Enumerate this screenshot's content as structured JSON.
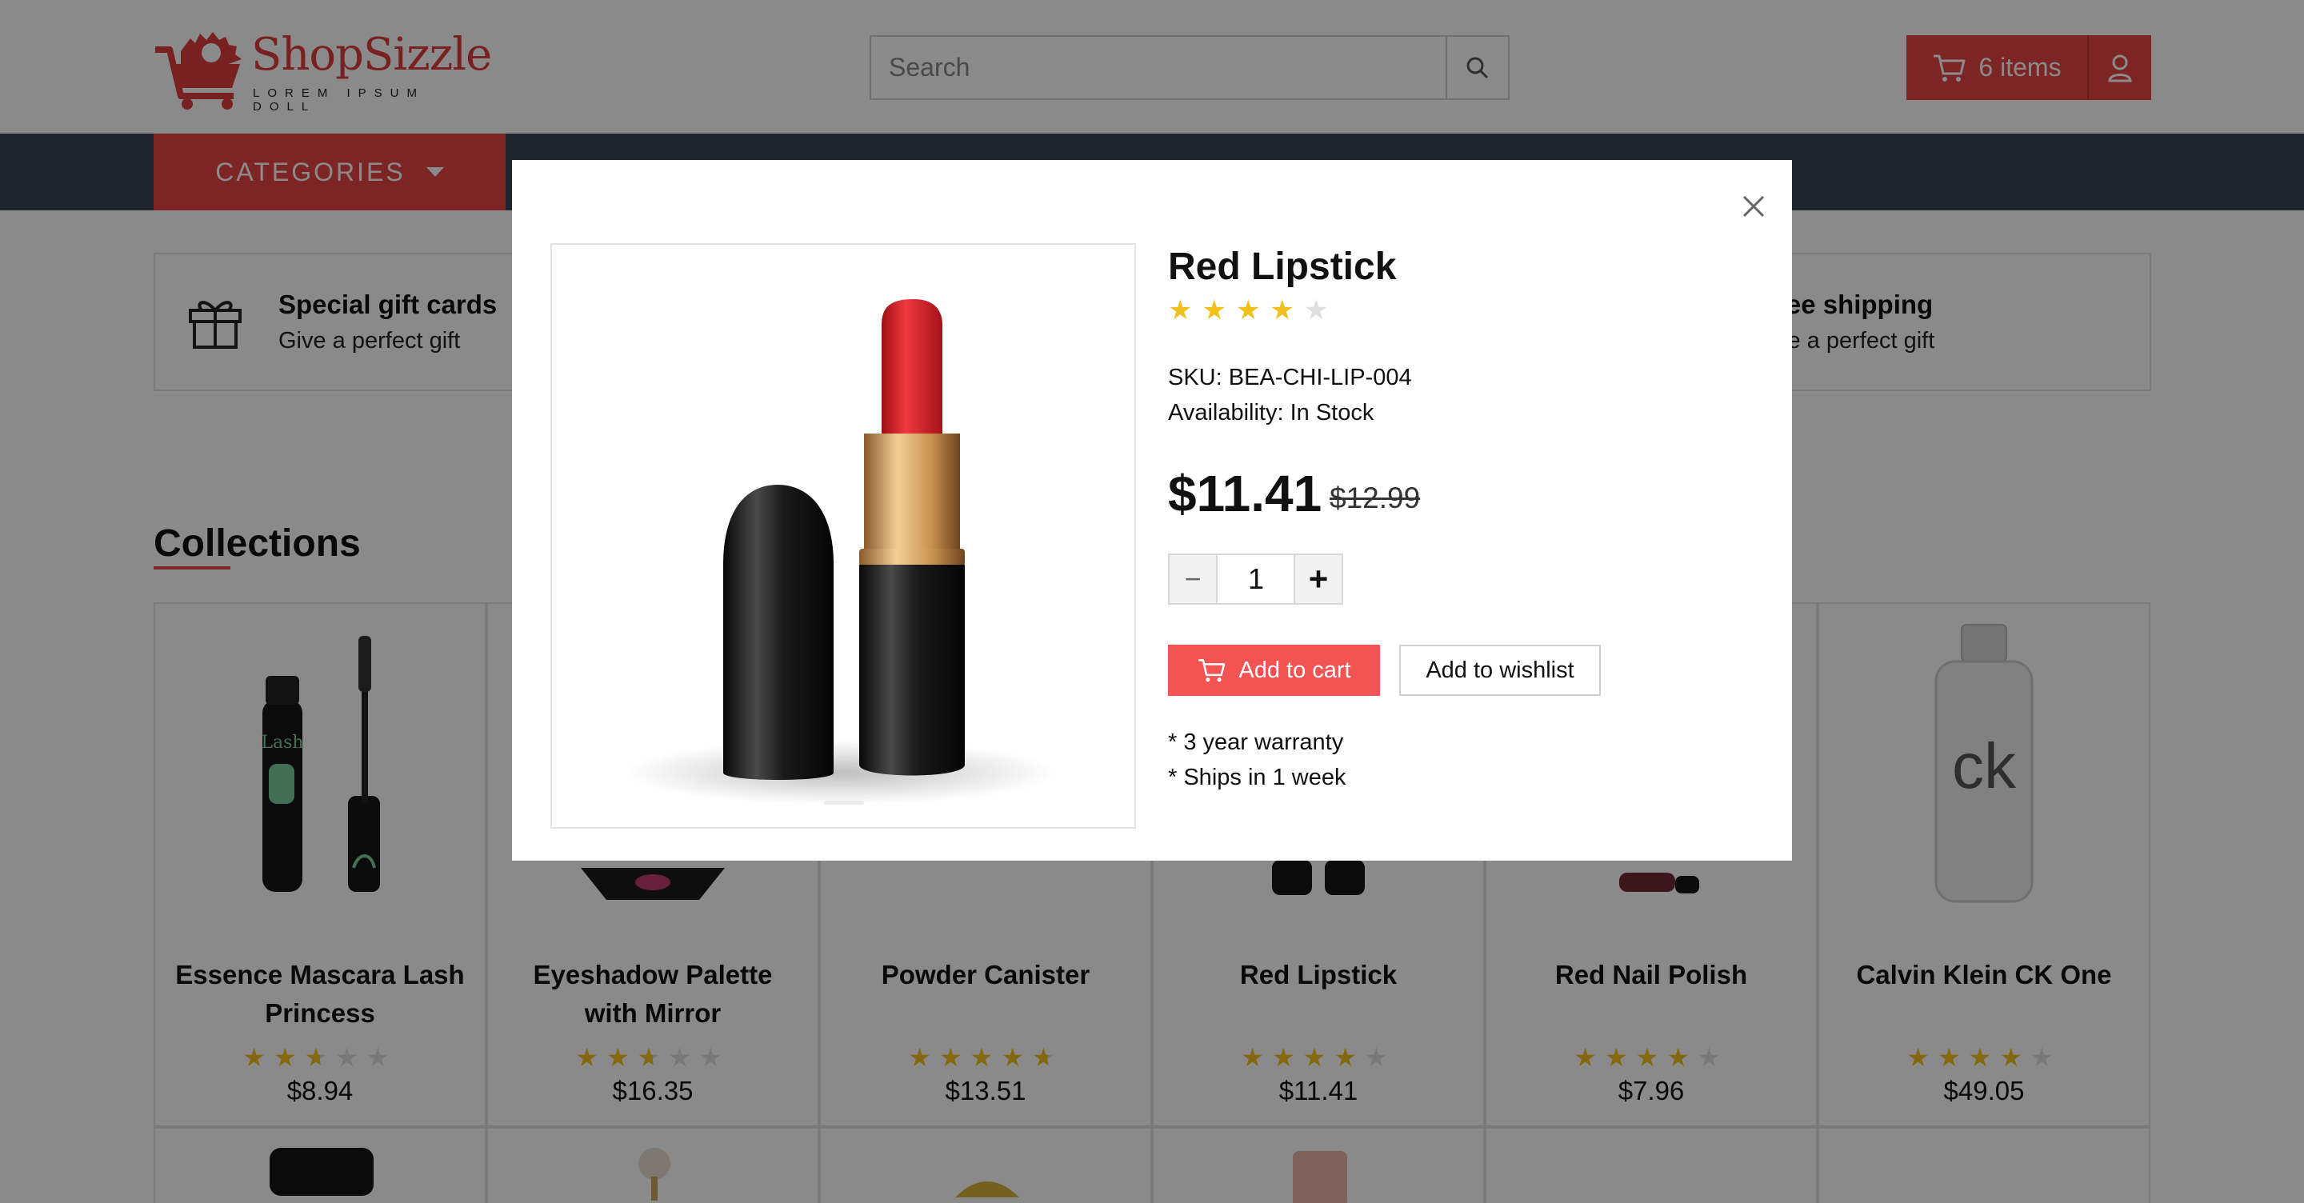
{
  "header": {
    "brand": "ShopSizzle",
    "tagline": "LOREM IPSUM DOLL",
    "search_placeholder": "Search",
    "cart_label": "6 items"
  },
  "nav": {
    "categories_label": "CATEGORIES"
  },
  "features": [
    {
      "title": "Special gift cards",
      "subtitle": "Give a perfect gift",
      "icon": "gift-icon"
    },
    {
      "title": "ree shipping",
      "subtitle": "ve a perfect gift",
      "icon": "truck-icon"
    }
  ],
  "collections": {
    "title": "Collections",
    "products": [
      {
        "name": "Essence Mascara Lash Princess",
        "rating": 2.5,
        "price": "$8.94"
      },
      {
        "name": "Eyeshadow Palette with Mirror",
        "rating": 2.5,
        "price": "$16.35"
      },
      {
        "name": "Powder Canister",
        "rating": 4.5,
        "price": "$13.51"
      },
      {
        "name": "Red Lipstick",
        "rating": 4,
        "price": "$11.41"
      },
      {
        "name": "Red Nail Polish",
        "rating": 4,
        "price": "$7.96"
      },
      {
        "name": "Calvin Klein CK One",
        "rating": 4,
        "price": "$49.05"
      }
    ]
  },
  "modal": {
    "title": "Red Lipstick",
    "rating": 4,
    "sku": "SKU: BEA-CHI-LIP-004",
    "availability": "Availability: In Stock",
    "price": "$11.41",
    "old_price": "$12.99",
    "quantity": "1",
    "add_to_cart": "Add to cart",
    "add_to_wishlist": "Add to wishlist",
    "notes": [
      "* 3 year warranty",
      "* Ships in 1 week"
    ]
  },
  "colors": {
    "accent": "#e84545",
    "nav": "#3a4654",
    "star": "#f2c01d"
  }
}
